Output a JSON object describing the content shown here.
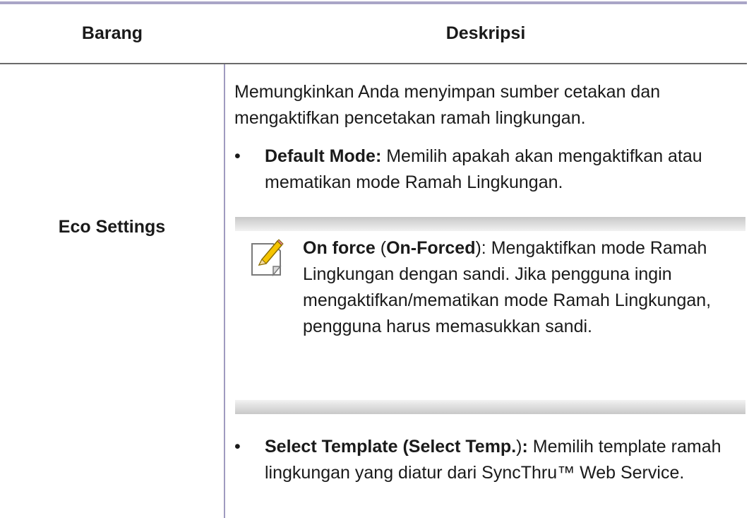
{
  "table": {
    "header_item": "Barang",
    "header_desc": "Deskripsi"
  },
  "row": {
    "item": "Eco Settings",
    "intro": "Memungkinkan Anda menyimpan sumber cetakan dan mengaktifkan pencetakan ramah lingkungan.",
    "bullet1": {
      "label": "Default Mode:",
      "text": " Memilih apakah akan mengaktifkan atau mematikan mode Ramah Lingkungan."
    },
    "note": {
      "icon": "note-pencil-icon",
      "label": "On force",
      "paren_open": " (",
      "label2": "On-Forced",
      "text": "): Mengaktifkan mode Ramah Lingkungan dengan sandi. Jika pengguna ingin mengaktifkan/mematikan mode Ramah Lingkungan, pengguna harus memasukkan sandi."
    },
    "bullet2": {
      "label": "Select Template (Select Temp.",
      "paren_close": ")",
      "colon": ":",
      "text": " Memilih template ramah lingkungan yang diatur dari SyncThru™ Web Service."
    },
    "bullet_glyph": "•"
  }
}
